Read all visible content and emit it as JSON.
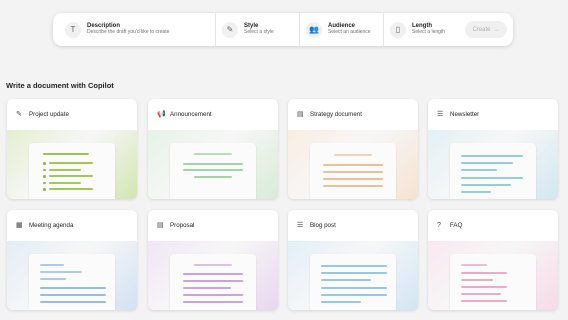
{
  "prompt_bar": {
    "fields": [
      {
        "icon": "text-icon",
        "label": "Description",
        "hint": "Describe the draft you'd like to create"
      },
      {
        "icon": "style-icon",
        "label": "Style",
        "hint": "Select a style"
      },
      {
        "icon": "audience-icon",
        "label": "Audience",
        "hint": "Select an audience"
      },
      {
        "icon": "length-icon",
        "label": "Length",
        "hint": "Select a length"
      }
    ],
    "create_label": "Create"
  },
  "section_title": "Write a document with Copilot",
  "cards": [
    {
      "title": "Project update",
      "icon": "edit-document-icon",
      "accent": "#8fbf3b"
    },
    {
      "title": "Announcement",
      "icon": "megaphone-icon",
      "accent": "#9bcf9a"
    },
    {
      "title": "Strategy document",
      "icon": "document-icon",
      "accent": "#e8b98a"
    },
    {
      "title": "Newsletter",
      "icon": "lines-icon",
      "accent": "#8cc6d8"
    },
    {
      "title": "Meeting agenda",
      "icon": "agenda-icon",
      "accent": "#8fb5e0"
    },
    {
      "title": "Proposal",
      "icon": "document-icon",
      "accent": "#c49ad8"
    },
    {
      "title": "Blog post",
      "icon": "lines-icon",
      "accent": "#8cc0e3"
    },
    {
      "title": "FAQ",
      "icon": "chat-question-icon",
      "accent": "#e7a3c1"
    }
  ]
}
